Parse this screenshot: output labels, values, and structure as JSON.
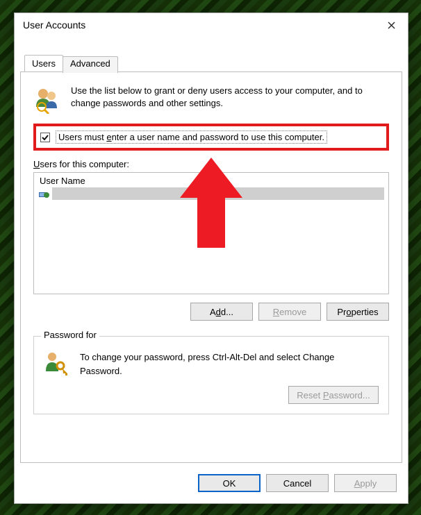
{
  "window": {
    "title": "User Accounts"
  },
  "tabs": {
    "users": "Users",
    "advanced": "Advanced"
  },
  "intro_text": "Use the list below to grant or deny users access to your computer, and to change passwords and other settings.",
  "checkbox": {
    "label_pre": "Users must ",
    "label_u": "e",
    "label_post": "nter a user name and password to use this computer."
  },
  "list_label_pre": "",
  "list_label_u": "U",
  "list_label_post": "sers for this computer:",
  "column_header": "User Name",
  "buttons": {
    "add": "Add...",
    "remove": "Remove",
    "properties": "Properties"
  },
  "password_group": {
    "caption": "Password for",
    "text": "To change your password, press Ctrl-Alt-Del and select Change Password.",
    "reset_btn_pre": "Reset ",
    "reset_btn_u": "P",
    "reset_btn_post": "assword..."
  },
  "dialog_buttons": {
    "ok": "OK",
    "cancel": "Cancel",
    "apply": "Apply"
  }
}
